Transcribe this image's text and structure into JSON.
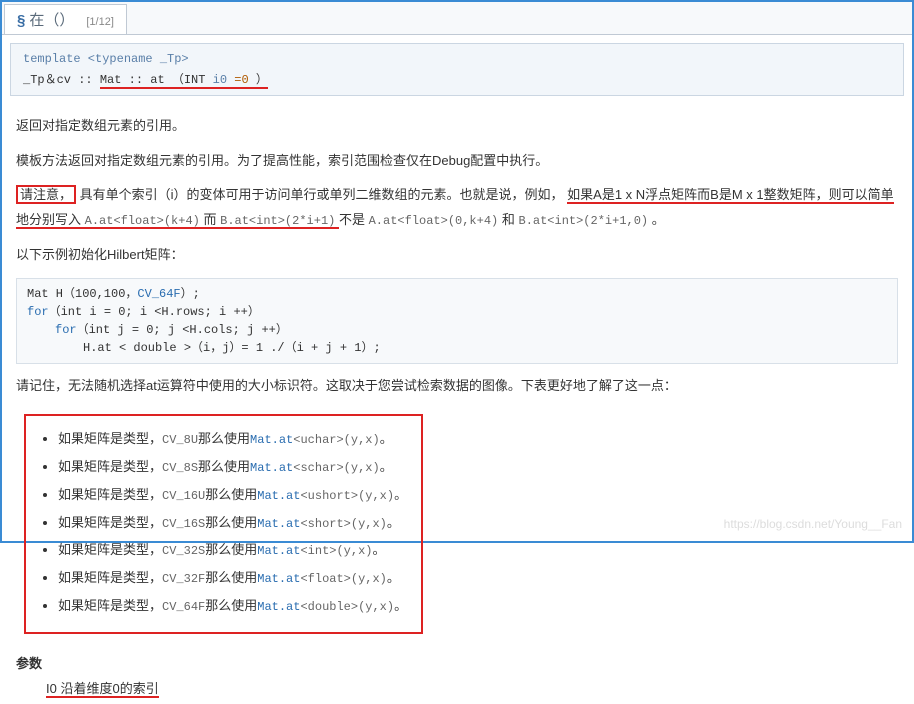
{
  "tab": {
    "symbol": "§",
    "word": "在（）",
    "index": "[1/12]"
  },
  "decl": {
    "line1": "template <typename _Tp>",
    "line2_prefix": "_Tp＆cv ::",
    "line2_mid": " Mat :: at （INT ",
    "line2_i0": "i0 ",
    "line2_eq": "=0",
    "line2_suffix": "）"
  },
  "para1": "返回对指定数组元素的引用。",
  "para2": "模板方法返回对指定数组元素的引用。为了提高性能，索引范围检查仅在Debug配置中执行。",
  "note_label": "请注意，",
  "note_mid1": "具有单个索引（i）的变体可用于访问单行或单列二维数组的元素。也就是说，例如，",
  "note_underlined": "如果A是1 x N浮点矩阵而B是M x 1整数矩阵，则可以简单地分别写入",
  "note_code1": "A.at<float>(k+4)",
  "note_and": "而",
  "note_code2": "B.at<int>(2*i+1)",
  "note_not": "不是",
  "note_code3": "A.at<float>(0,k+4)",
  "note_he": "和",
  "note_code4": "B.at<int>(2*i+1,0)",
  "note_period": "。",
  "para3": "以下示例初始化Hilbert矩阵：",
  "code": {
    "l1a": "Mat H（100,100，",
    "l1b": "CV_64F",
    "l1c": "）;",
    "l2a": "for",
    "l2b": "（int i = 0; i <H.rows; i ++）",
    "l3a": "for",
    "l3b": "（int j = 0; j <H.cols; j ++）",
    "l4": "H.at < double >（i，j）= 1 ./（i + j + 1）;"
  },
  "para4": "请记住，无法随机选择at运算符中使用的大小标识符。这取决于您尝试检索数据的图像。下表更好地了解了这一点：",
  "bullets": [
    {
      "pre": "如果矩阵是类型，",
      "cv": "CV_8U",
      "mid": "那么使用",
      "fn": "Mat.at",
      "args": "<uchar>(y,x)",
      "suf": "。"
    },
    {
      "pre": "如果矩阵是类型，",
      "cv": "CV_8S",
      "mid": "那么使用",
      "fn": "Mat.at",
      "args": "<schar>(y,x)",
      "suf": "。"
    },
    {
      "pre": "如果矩阵是类型，",
      "cv": "CV_16U",
      "mid": "那么使用",
      "fn": "Mat.at",
      "args": "<ushort>(y,x)",
      "suf": "。"
    },
    {
      "pre": "如果矩阵是类型，",
      "cv": "CV_16S",
      "mid": "那么使用",
      "fn": "Mat.at",
      "args": "<short>(y,x)",
      "suf": "。"
    },
    {
      "pre": "如果矩阵是类型，",
      "cv": "CV_32S",
      "mid": "那么使用",
      "fn": "Mat.at",
      "args": "<int>(y,x)",
      "suf": "。"
    },
    {
      "pre": "如果矩阵是类型，",
      "cv": "CV_32F",
      "mid": "那么使用",
      "fn": "Mat.at",
      "args": "<float>(y,x)",
      "suf": "。"
    },
    {
      "pre": "如果矩阵是类型，",
      "cv": "CV_64F",
      "mid": "那么使用",
      "fn": "Mat.at",
      "args": "<double>(y,x)",
      "suf": "。"
    }
  ],
  "params_head": "参数",
  "params_i0": "I0",
  "params_i0_desc": " 沿着维度0的索引",
  "watermark": "https://blog.csdn.net/Young__Fan"
}
